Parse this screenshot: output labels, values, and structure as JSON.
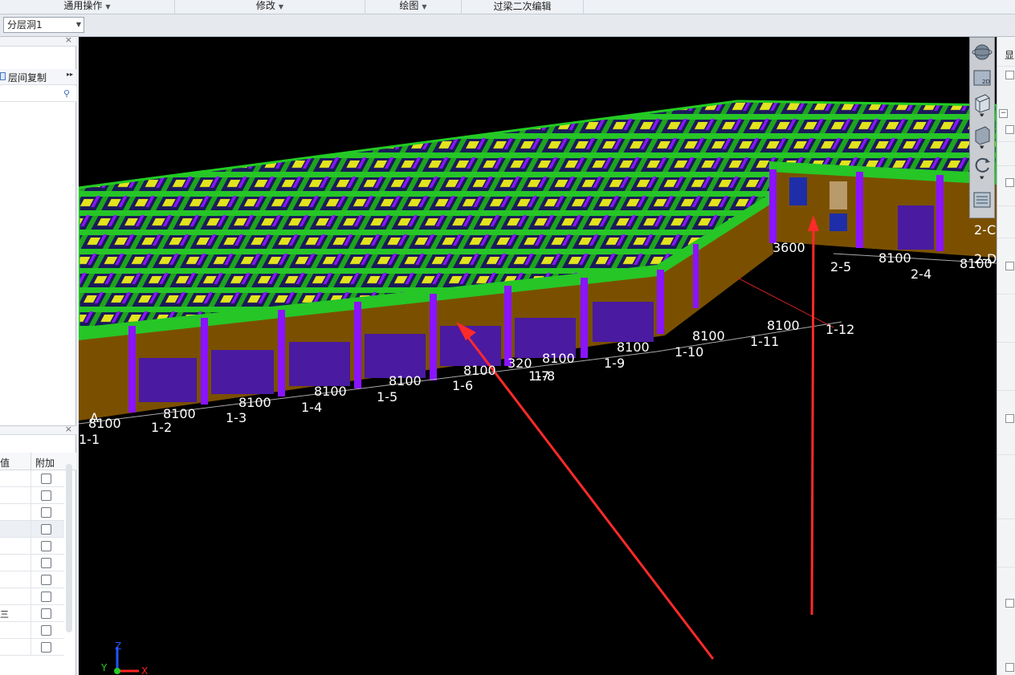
{
  "ribbon": {
    "groups": [
      {
        "label": "通用操作"
      },
      {
        "label": "修改"
      },
      {
        "label": "绘图"
      },
      {
        "label": "过梁二次编辑"
      }
    ]
  },
  "toolbar": {
    "floor_select_value": "分层洞1"
  },
  "left_panel": {
    "copy_label": "层间复制",
    "search_placeholder": ""
  },
  "property_panel": {
    "col_value": "值",
    "col_extra": "附加",
    "side_text": "三"
  },
  "right_panel": {
    "title": "显"
  },
  "viewport": {
    "axis_labels_front": [
      "1-1",
      "1-2",
      "1-3",
      "1-4",
      "1-5",
      "1-6",
      "1-7",
      "1-8",
      "1-9",
      "1-10",
      "1-11",
      "1-12"
    ],
    "dimensions_front": [
      "8100",
      "8100",
      "8100",
      "8100",
      "8100",
      "8100",
      "320",
      "8100",
      "8100",
      "8100",
      "8100"
    ],
    "axis_labels_back": [
      "2-5",
      "2-4"
    ],
    "dimensions_back": [
      "3600",
      "8100",
      "8100"
    ],
    "axis_label_side": [
      "2-C",
      "2-D"
    ],
    "corner_axis": "A",
    "triad": {
      "x": "X",
      "y": "Y",
      "z": "Z"
    },
    "colors": {
      "beam": "#22cc22",
      "column": "#8a14ff",
      "wall": "#8a5a00",
      "slab": "#ffff33",
      "annotation": "#ff2a2a"
    }
  }
}
